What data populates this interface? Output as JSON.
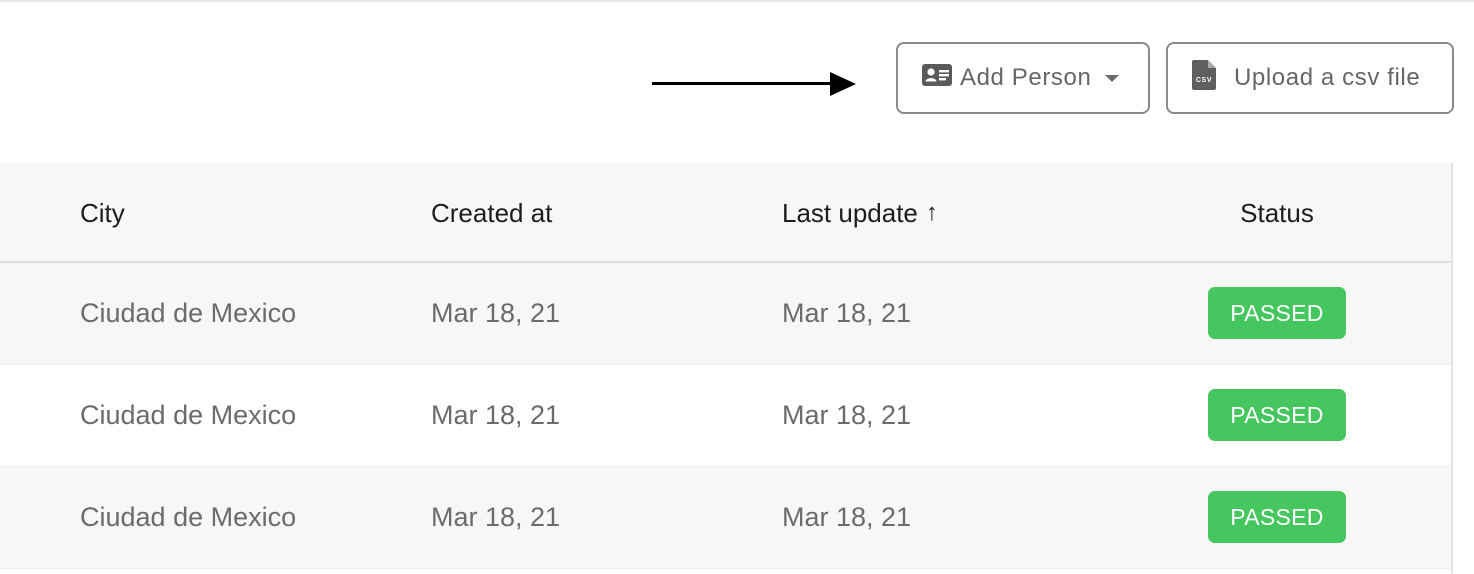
{
  "toolbar": {
    "add_person_label": "Add Person",
    "upload_label": "Upload a csv file",
    "upload_icon_text": "CSV"
  },
  "table": {
    "columns": [
      "City",
      "Created at",
      "Last update",
      "Status"
    ],
    "sort_indicator": "↑",
    "rows": [
      {
        "city": "Ciudad de Mexico",
        "created": "Mar 18, 21",
        "updated": "Mar 18, 21",
        "status": "PASSED"
      },
      {
        "city": "Ciudad de Mexico",
        "created": "Mar 18, 21",
        "updated": "Mar 18, 21",
        "status": "PASSED"
      },
      {
        "city": "Ciudad de Mexico",
        "created": "Mar 18, 21",
        "updated": "Mar 18, 21",
        "status": "PASSED"
      }
    ]
  },
  "colors": {
    "passed_badge": "#45c65e",
    "button_border": "#8a8a8a",
    "header_background": "#f7f7f7"
  },
  "icons": [
    "id-card-icon",
    "chevron-down-icon",
    "csv-file-icon",
    "arrow-right-icon"
  ]
}
